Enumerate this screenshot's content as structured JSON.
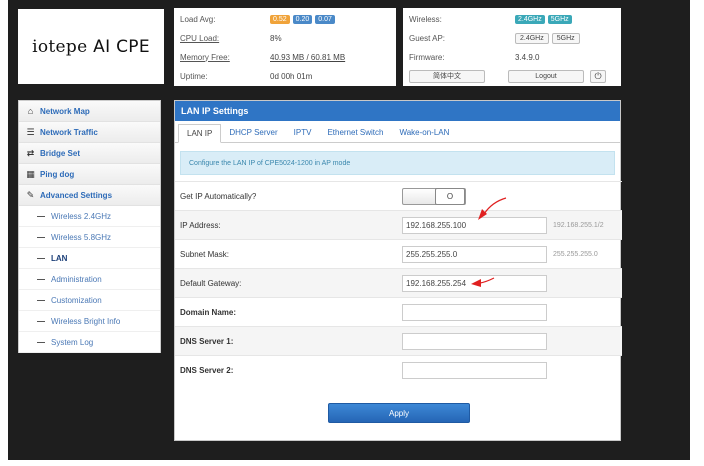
{
  "brand": {
    "name": "iotepe",
    "suffix": "AI CPE"
  },
  "status_left": {
    "load_avg": {
      "label": "Load Avg:",
      "values": [
        "0.52",
        "0.20",
        "0.07"
      ]
    },
    "cpu_load": {
      "label": "CPU Load:",
      "value": "8%"
    },
    "memory_free": {
      "label": "Memory Free:",
      "value": "40.93 MB / 60.81 MB"
    },
    "uptime": {
      "label": "Uptime:",
      "value": "0d 00h 01m"
    }
  },
  "status_right": {
    "wireless": {
      "label": "Wireless:",
      "values": [
        "2.4GHz",
        "5GHz"
      ]
    },
    "guest_ap": {
      "label": "Guest AP:",
      "values": [
        "2.4GHz",
        "5GHz"
      ]
    },
    "firmware": {
      "label": "Firmware:",
      "value": "3.4.9.0"
    },
    "language": "简体中文",
    "logout": "Logout"
  },
  "sidebar": {
    "items": [
      {
        "label": "Network Map",
        "icon": "home-icon",
        "glyph": "⌂"
      },
      {
        "label": "Network Traffic",
        "icon": "list-icon",
        "glyph": "☰"
      },
      {
        "label": "Bridge Set",
        "icon": "shuffle-icon",
        "glyph": "⇄"
      },
      {
        "label": "Ping dog",
        "icon": "grid-icon",
        "glyph": "▦"
      },
      {
        "label": "Advanced Settings",
        "icon": "wrench-icon",
        "glyph": "✎"
      }
    ],
    "sub_items": [
      {
        "label": "Wireless 2.4GHz"
      },
      {
        "label": "Wireless 5.8GHz"
      },
      {
        "label": "LAN"
      },
      {
        "label": "Administration"
      },
      {
        "label": "Customization"
      },
      {
        "label": "Wireless Bright Info"
      },
      {
        "label": "System Log"
      }
    ]
  },
  "panel": {
    "title": "LAN IP Settings",
    "tabs": [
      "LAN IP",
      "DHCP Server",
      "IPTV",
      "Ethernet Switch",
      "Wake-on-LAN"
    ],
    "note": "Configure the LAN IP of CPE5024-1200 in AP mode",
    "fields": {
      "get_ip_auto": {
        "label": "Get IP Automatically?",
        "toggle": "O"
      },
      "ip_address": {
        "label": "IP Address:",
        "value": "192.168.255.100",
        "hint": "192.168.255.1/2"
      },
      "subnet_mask": {
        "label": "Subnet Mask:",
        "value": "255.255.255.0",
        "hint": "255.255.255.0"
      },
      "default_gateway": {
        "label": "Default Gateway:",
        "value": "192.168.255.254"
      },
      "domain_name": {
        "label": "Domain Name:",
        "value": ""
      },
      "dns1": {
        "label": "DNS Server 1:",
        "value": ""
      },
      "dns2": {
        "label": "DNS Server 2:",
        "value": ""
      }
    },
    "apply": "Apply"
  },
  "colors": {
    "accent": "#2f75c5",
    "arrow": "#e02020",
    "frame": "#1e1e1e"
  }
}
